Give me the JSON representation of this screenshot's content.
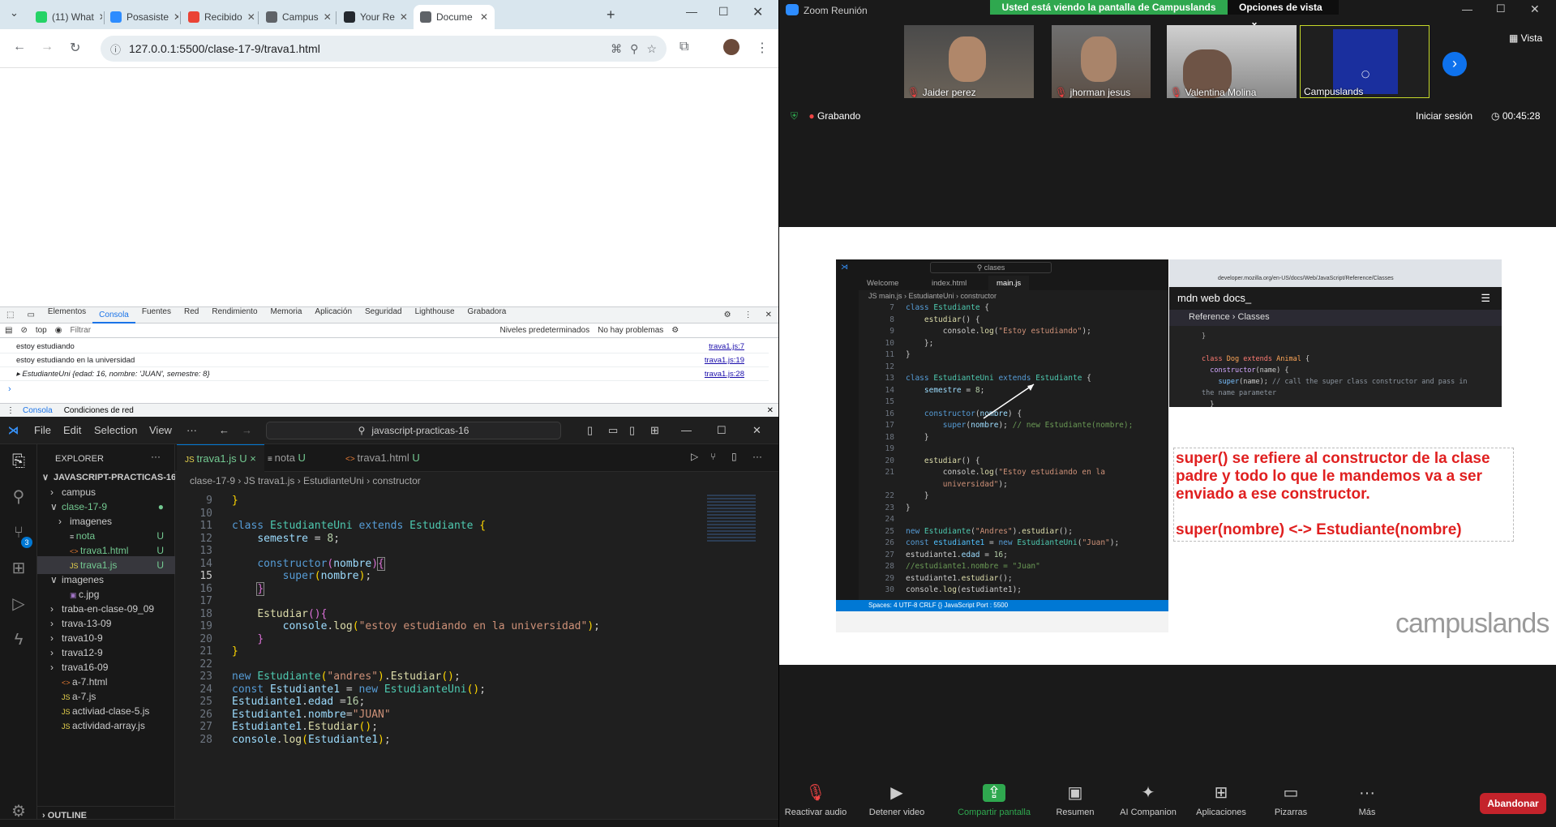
{
  "browser": {
    "tabs": [
      {
        "label": "(11) What",
        "color": "#25d366"
      },
      {
        "label": "Posasiste",
        "color": "#2d8cff"
      },
      {
        "label": "Recibido",
        "color": "#ea4335"
      },
      {
        "label": "Campus",
        "color": "#5f6368"
      },
      {
        "label": "Your Re",
        "color": "#24292f"
      },
      {
        "label": "Docume",
        "color": "#5f6368"
      }
    ],
    "url": "127.0.0.1:5500/clase-17-9/trava1.html"
  },
  "devtools": {
    "tabs": [
      "Elementos",
      "Consola",
      "Fuentes",
      "Red",
      "Rendimiento",
      "Memoria",
      "Aplicación",
      "Seguridad",
      "Lighthouse",
      "Grabadora"
    ],
    "active_tab": "Consola",
    "toolbar": {
      "context": "top",
      "filter": "Filtrar",
      "levels": "Niveles predeterminados",
      "issues": "No hay problemas"
    },
    "logs": [
      {
        "text": "estoy estudiando",
        "src": "trava1.js:7"
      },
      {
        "text": "estoy estudiando en la universidad",
        "src": "trava1.js:19"
      },
      {
        "text": "▸ EstudianteUni {edad: 16, nombre: 'JUAN', semestre: 8}",
        "src": "trava1.js:28"
      }
    ],
    "drawer_tabs": [
      "Consola",
      "Condiciones de red"
    ]
  },
  "vscode": {
    "menu": [
      "File",
      "Edit",
      "Selection",
      "View",
      "···"
    ],
    "search": "javascript-practicas-16",
    "explorer_title": "EXPLORER",
    "tree": [
      {
        "label": "JAVASCRIPT-PRACTICAS-16",
        "indent": 0,
        "arrow": "∨",
        "badge": "",
        "bold": true
      },
      {
        "label": "campus",
        "indent": 1,
        "arrow": "›",
        "badge": ""
      },
      {
        "label": "clase-17-9",
        "indent": 1,
        "arrow": "∨",
        "badge": "●"
      },
      {
        "label": "imagenes",
        "indent": 2,
        "arrow": "›",
        "badge": ""
      },
      {
        "label": "nota",
        "indent": 2,
        "arrow": "",
        "badge": "U"
      },
      {
        "label": "trava1.html",
        "indent": 2,
        "arrow": "",
        "badge": "U"
      },
      {
        "label": "trava1.js",
        "indent": 2,
        "arrow": "",
        "badge": "U"
      },
      {
        "label": "imagenes",
        "indent": 1,
        "arrow": "∨",
        "badge": ""
      },
      {
        "label": "c.jpg",
        "indent": 2,
        "arrow": "",
        "badge": ""
      },
      {
        "label": "traba-en-clase-09_09",
        "indent": 1,
        "arrow": "›",
        "badge": ""
      },
      {
        "label": "trava-13-09",
        "indent": 1,
        "arrow": "›",
        "badge": ""
      },
      {
        "label": "trava10-9",
        "indent": 1,
        "arrow": "›",
        "badge": ""
      },
      {
        "label": "trava12-9",
        "indent": 1,
        "arrow": "›",
        "badge": ""
      },
      {
        "label": "trava16-09",
        "indent": 1,
        "arrow": "›",
        "badge": ""
      },
      {
        "label": "a-7.html",
        "indent": 1,
        "arrow": "",
        "badge": ""
      },
      {
        "label": "a-7.js",
        "indent": 1,
        "arrow": "",
        "badge": ""
      },
      {
        "label": "activiad-clase-5.js",
        "indent": 1,
        "arrow": "",
        "badge": ""
      },
      {
        "label": "actividad-array.js",
        "indent": 1,
        "arrow": "",
        "badge": ""
      }
    ],
    "outline": "OUTLINE",
    "editor_tabs": [
      {
        "label": "trava1.js",
        "suffix": "U ×"
      },
      {
        "label": "nota",
        "suffix": "U"
      },
      {
        "label": "trava1.html",
        "suffix": "U"
      }
    ],
    "breadcrumb": "clase-17-9 › JS trava1.js › EstudianteUni › constructor",
    "first_line": 9,
    "current_line": 15
  },
  "zoom": {
    "title": "Zoom Reunión",
    "banner": "Usted está viendo la pantalla de Campuslands",
    "view_options": "Opciones de vista",
    "view_label": "Vista",
    "participants": [
      "Jaider perez",
      "jhorman jesus",
      "Valentina Molina",
      "Campuslands"
    ],
    "recording": "Grabando",
    "signin": "Iniciar sesión",
    "timer": "00:45:28",
    "controls": [
      "Reactivar audio",
      "Detener video",
      "Compartir pantalla",
      "Resumen",
      "AI Companion",
      "Aplicaciones",
      "Pizarras",
      "Más"
    ],
    "leave": "Abandonar",
    "note_line1": "super() se refiere al constructor de la clase padre y todo lo que le mandemos va a ser enviado a ese constructor.",
    "note_line2": "super(nombre) <-> Estudiante(nombre)",
    "watermark": "campuslands",
    "shared_tabs": [
      "Welcome",
      "index.html",
      "main.js"
    ],
    "shared_search": "clases",
    "shared_crumb": "JS main.js › EstudianteUni › constructor",
    "mdn_logo": "mdn web docs_",
    "mdn_crumb": "Reference › Classes",
    "mdn_url": "developer.mozilla.org/en-US/docs/Web/JavaScript/Reference/Classes",
    "shared_status": "Spaces: 4   UTF-8   CRLF   {} JavaScript   Port : 5500"
  },
  "colors": {
    "zoom_green": "#2fa84f",
    "leave_red": "#c4232b",
    "vscode_blue": "#0078d4",
    "note_red": "#e02020"
  }
}
